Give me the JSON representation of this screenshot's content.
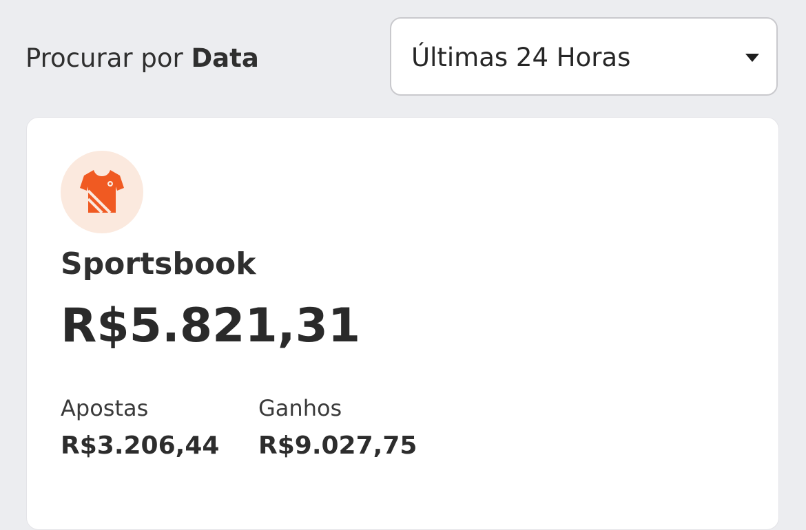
{
  "filter": {
    "label_prefix": "Procurar por ",
    "label_bold": "Data",
    "selected": "Últimas 24 Horas",
    "caret_icon": "chevron-down-icon"
  },
  "card": {
    "icon": "jersey-icon",
    "icon_color": "#f05a22",
    "icon_bg": "#fbe9de",
    "title": "Sportsbook",
    "total": "R$5.821,31",
    "stats": [
      {
        "label": "Apostas",
        "value": "R$3.206,44"
      },
      {
        "label": "Ganhos",
        "value": "R$9.027,75"
      }
    ]
  }
}
